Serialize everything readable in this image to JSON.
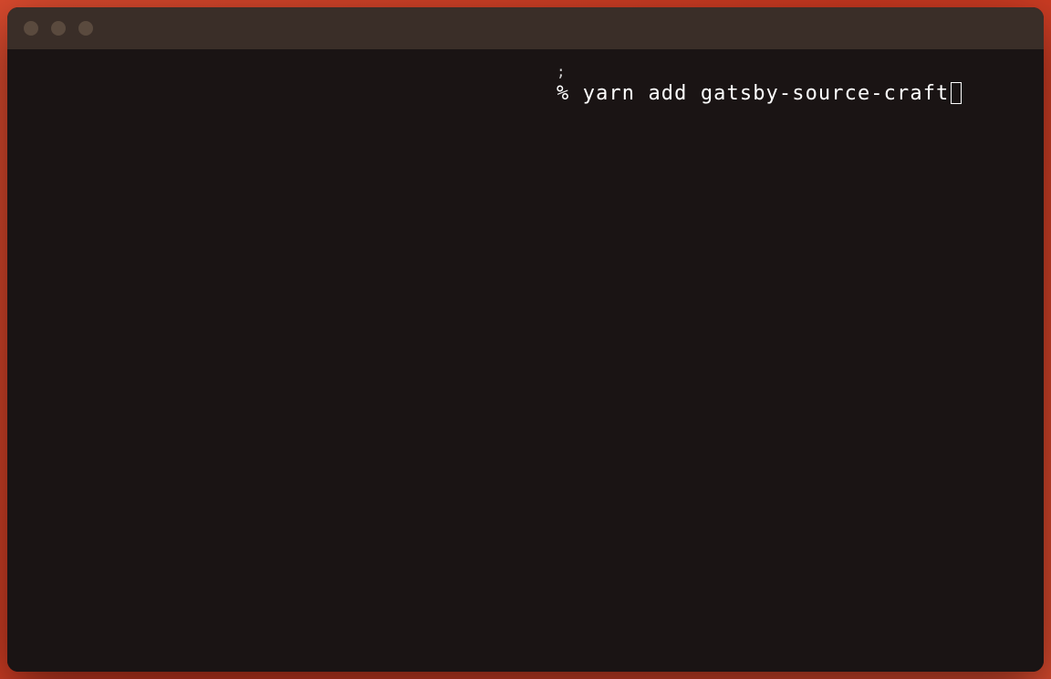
{
  "terminal": {
    "prompt_symbol": "%",
    "command": "yarn add gatsby-source-craft",
    "artifact_char": ";"
  },
  "window": {
    "traffic_lights": [
      "close",
      "minimize",
      "maximize"
    ]
  }
}
